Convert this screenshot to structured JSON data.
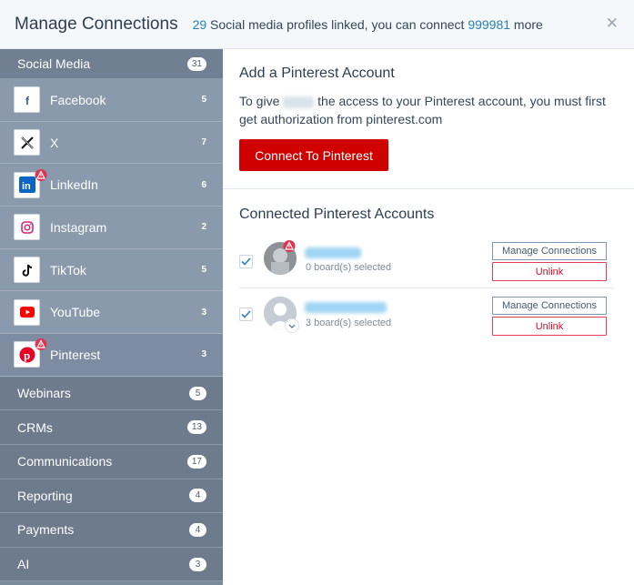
{
  "header": {
    "title": "Manage Connections",
    "linked_count": "29",
    "linked_text": " Social media profiles linked, you can connect ",
    "remaining_count": "999981",
    "remaining_text": " more",
    "close_icon": "close-icon"
  },
  "sidebar": {
    "social": {
      "label": "Social Media",
      "count": "31"
    },
    "items": [
      {
        "label": "Facebook",
        "count": "5",
        "icon": "facebook-icon",
        "warning": false
      },
      {
        "label": "X",
        "count": "7",
        "icon": "x-icon",
        "warning": false
      },
      {
        "label": "LinkedIn",
        "count": "6",
        "icon": "linkedin-icon",
        "warning": true
      },
      {
        "label": "Instagram",
        "count": "2",
        "icon": "instagram-icon",
        "warning": false
      },
      {
        "label": "TikTok",
        "count": "5",
        "icon": "tiktok-icon",
        "warning": false
      },
      {
        "label": "YouTube",
        "count": "3",
        "icon": "youtube-icon",
        "warning": false
      },
      {
        "label": "Pinterest",
        "count": "3",
        "icon": "pinterest-icon",
        "warning": true
      }
    ],
    "categories": [
      {
        "label": "Webinars",
        "count": "5"
      },
      {
        "label": "CRMs",
        "count": "13"
      },
      {
        "label": "Communications",
        "count": "17"
      },
      {
        "label": "Reporting",
        "count": "4"
      },
      {
        "label": "Payments",
        "count": "4"
      },
      {
        "label": "AI",
        "count": "3"
      }
    ]
  },
  "main": {
    "add_title": "Add a Pinterest Account",
    "add_text_1": "To give",
    "add_text_2": " the access to your Pinterest account, you must first get authorization from pinterest.com",
    "connect_button": "Connect To Pinterest",
    "connected_title": "Connected Pinterest Accounts",
    "accounts": [
      {
        "boards": "0 board(s) selected",
        "manage": "Manage Connections",
        "unlink": "Unlink",
        "checked": true,
        "warning": true
      },
      {
        "boards": "3 board(s) selected",
        "manage": "Manage Connections",
        "unlink": "Unlink",
        "checked": true,
        "warning": false
      }
    ]
  },
  "colors": {
    "accent_blue": "#2a7fb0",
    "pinterest_red": "#d10000",
    "sidebar": "#8a99ab",
    "warning": "#e0334f"
  }
}
